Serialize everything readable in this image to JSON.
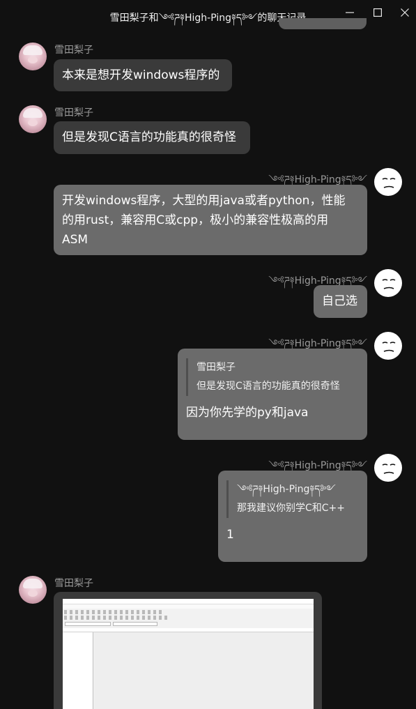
{
  "window": {
    "title": "雪田梨子和༺ཌ༈High-Ping༈ད༻的聊天记录",
    "minimize_icon": "minimize-icon",
    "maximize_icon": "maximize-icon",
    "close_icon": "close-icon"
  },
  "contacts": {
    "other": "雪田梨子",
    "me": "༺ཌ༈High-Ping༈ད༻"
  },
  "messages": [
    {
      "sender": "雪田梨子",
      "text": "本来是想开发windows程序的"
    },
    {
      "sender": "雪田梨子",
      "text": "但是发现C语言的功能真的很奇怪"
    },
    {
      "sender": "༺ཌ༈High-Ping༈ད༻",
      "lines": [
        "开发windows程序，大型的用java或者python，性能",
        "的用rust，兼容用C或cpp，极小的兼容性极高的用",
        "ASM"
      ]
    },
    {
      "sender": "༺ཌ༈High-Ping༈ད༻",
      "text": "自己选"
    },
    {
      "sender": "༺ཌ༈High-Ping༈ད༻",
      "quote_name": "雪田梨子",
      "quote_text": "但是发现C语言的功能真的很奇怪",
      "text": "因为你先学的py和java"
    },
    {
      "sender": "༺ཌ༈High-Ping༈ད༻",
      "quote_name": "༺ཌ༈High-Ping༈ད༻",
      "quote_text": "那我建议你别学C和C++",
      "text": "1"
    },
    {
      "sender": "雪田梨子",
      "type": "image"
    }
  ],
  "colors": {
    "background": "#111111",
    "other_bubble": "#3a3a3a",
    "my_bubble": "#6b6b6b",
    "name_text": "#9a9a9a"
  }
}
